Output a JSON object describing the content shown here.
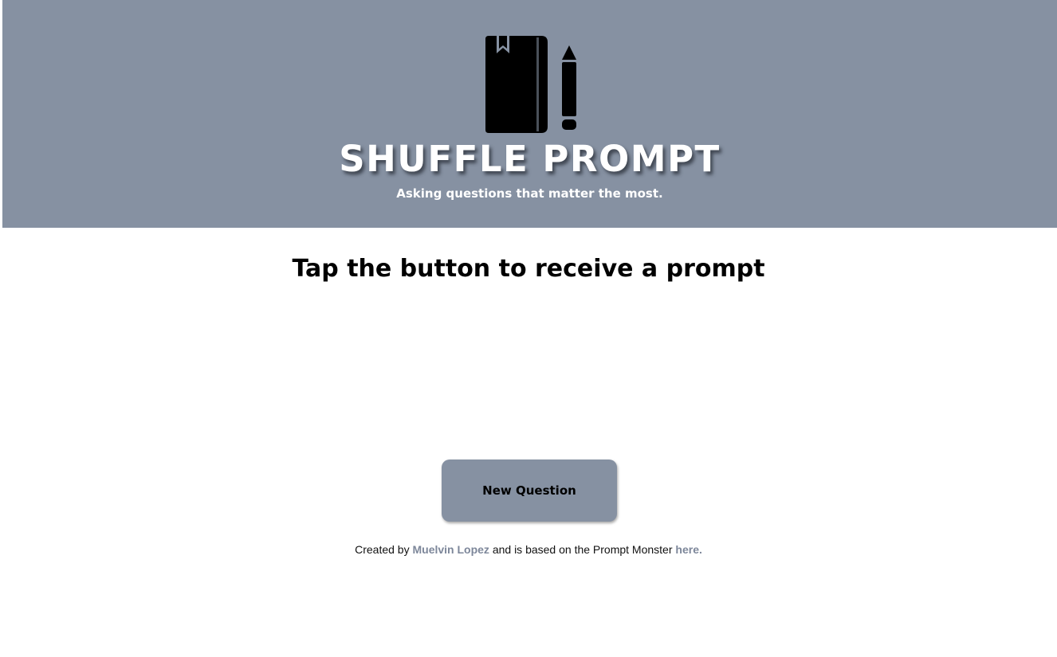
{
  "colors": {
    "header_background": "#8691a2",
    "button_background": "#8691a2",
    "link": "#7d879a",
    "title_text": "#ffffff"
  },
  "header": {
    "logo_icon": "notebook-pencil-icon",
    "title": "SHUFFLE PROMPT",
    "tagline": "Asking questions that matter the most."
  },
  "main": {
    "heading": "Tap the button to receive a prompt",
    "button_label": "New Question"
  },
  "footer": {
    "prefix": "Created by ",
    "author_link": "Muelvin Lopez",
    "middle": " and is based on the Prompt Monster ",
    "source_link": "here."
  }
}
